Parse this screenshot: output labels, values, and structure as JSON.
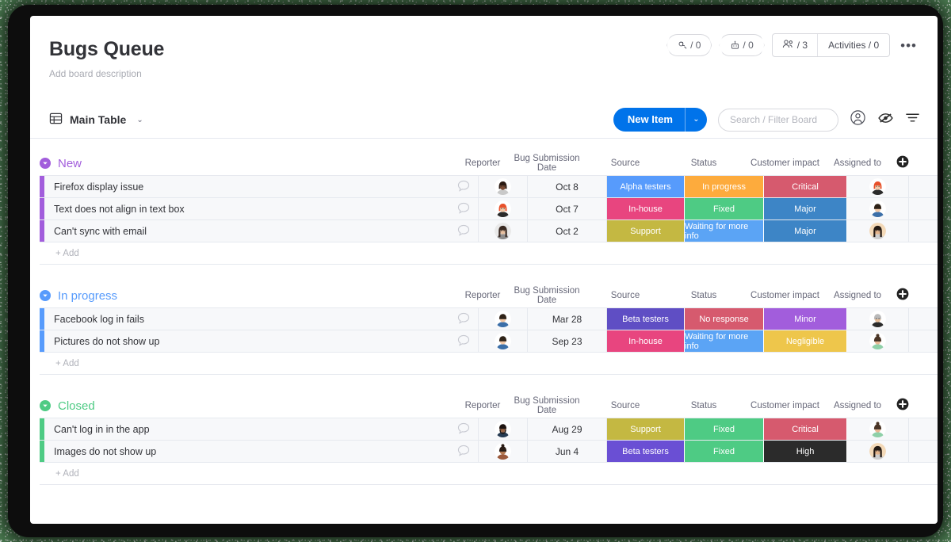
{
  "board": {
    "title": "Bugs Queue",
    "description": "Add board description",
    "view_tab": "Main Table",
    "view_caret": "⌄"
  },
  "header": {
    "badges": [
      {
        "icon": "automations-icon",
        "label": "/ 0"
      },
      {
        "icon": "integrations-icon",
        "label": "/ 0"
      }
    ],
    "people_count": "/ 3",
    "activities": "Activities / 0",
    "more": "•••"
  },
  "toolbar": {
    "new_item_label": "New Item",
    "new_item_caret": "⌄",
    "search_placeholder": "Search / Filter Board",
    "search_value": "",
    "person_icon": "person-circle-icon",
    "hide_icon": "eye-slash-icon",
    "filter_icon": "filter-icon",
    "accent_color": "#0073ea"
  },
  "columns": {
    "name": "",
    "reporter": "Reporter",
    "date": "Bug Submission Date",
    "source": "Source",
    "status": "Status",
    "impact": "Customer impact",
    "assigned": "Assigned to",
    "add_column": "+"
  },
  "add_row_label": "+ Add",
  "groups": [
    {
      "name": "New",
      "color": "#a25ddc",
      "items": [
        {
          "name": "Firefox display issue",
          "reporter_avatar": "avatar-dark-woman",
          "date": "Oct 8",
          "source": {
            "label": "Alpha testers",
            "color": "#579bfc"
          },
          "status": {
            "label": "In progress",
            "color": "#fdab3d"
          },
          "impact": {
            "label": "Critical",
            "color": "#d65a6e"
          },
          "assigned_avatar": "avatar-red-hair-woman"
        },
        {
          "name": "Text does not align in text box",
          "reporter_avatar": "avatar-red-hair-woman",
          "date": "Oct 7",
          "source": {
            "label": "In-house",
            "color": "#e8457f"
          },
          "status": {
            "label": "Fixed",
            "color": "#4ecb84"
          },
          "impact": {
            "label": "Major",
            "color": "#3d85c6"
          },
          "assigned_avatar": "avatar-young-man"
        },
        {
          "name": "Can't sync with email",
          "reporter_avatar": "avatar-long-hair-woman",
          "date": "Oct 2",
          "source": {
            "label": "Support",
            "color": "#c4b842"
          },
          "status": {
            "label": "Waiting for more info",
            "color": "#5ba4f5"
          },
          "impact": {
            "label": "Major",
            "color": "#3d85c6"
          },
          "assigned_avatar": "avatar-dark-long-hair"
        }
      ]
    },
    {
      "name": "In progress",
      "color": "#579bfc",
      "items": [
        {
          "name": "Facebook log in fails",
          "reporter_avatar": "avatar-young-man",
          "date": "Mar 28",
          "source": {
            "label": "Beta testers",
            "color": "#5f4ec4"
          },
          "status": {
            "label": "No response",
            "color": "#d65a6e"
          },
          "impact": {
            "label": "Minor",
            "color": "#a25ddc"
          },
          "assigned_avatar": "avatar-older-man"
        },
        {
          "name": "Pictures do not show up",
          "reporter_avatar": "avatar-young-man",
          "date": "Sep 23",
          "source": {
            "label": "In-house",
            "color": "#e8457f"
          },
          "status": {
            "label": "Waiting for more info",
            "color": "#5ba4f5"
          },
          "impact": {
            "label": "Negligible",
            "color": "#eec64b"
          },
          "assigned_avatar": "avatar-bun-woman"
        }
      ]
    },
    {
      "name": "Closed",
      "color": "#4ecb84",
      "items": [
        {
          "name": "Can't log in in the app",
          "reporter_avatar": "avatar-beard-man",
          "date": "Aug 29",
          "source": {
            "label": "Support",
            "color": "#c4b842"
          },
          "status": {
            "label": "Fixed",
            "color": "#4ecb84"
          },
          "impact": {
            "label": "Critical",
            "color": "#d65a6e"
          },
          "assigned_avatar": "avatar-bun-woman"
        },
        {
          "name": "Images do not show up",
          "reporter_avatar": "avatar-ponytail-woman",
          "date": "Jun 4",
          "source": {
            "label": "Beta testers",
            "color": "#6a4fd4"
          },
          "status": {
            "label": "Fixed",
            "color": "#4ecb84"
          },
          "impact": {
            "label": "High",
            "color": "#2b2b2b"
          },
          "assigned_avatar": "avatar-dark-long-hair"
        }
      ]
    }
  ]
}
